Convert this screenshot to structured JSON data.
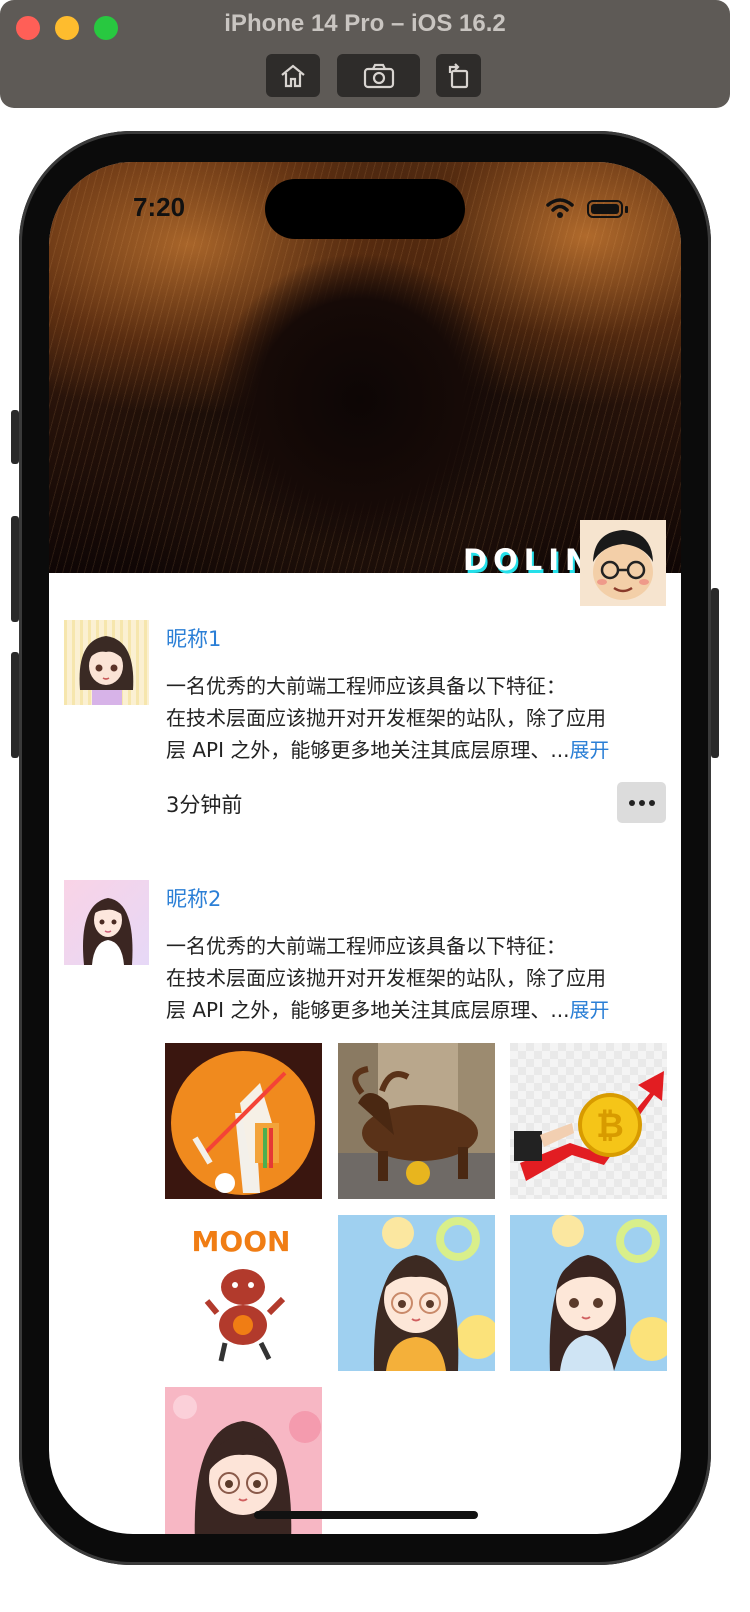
{
  "simulator": {
    "title": "iPhone 14 Pro – iOS 16.2",
    "buttons": [
      "home",
      "screenshot",
      "rotate"
    ]
  },
  "status_bar": {
    "time": "7:20"
  },
  "profile": {
    "brand_text": "DOLIN"
  },
  "posts": [
    {
      "nickname": "昵称1",
      "text_lines": [
        "一名优秀的大前端工程师应该具备以下特征：",
        "在技术层面应该抛开对开发框架的站队，除了应用",
        "层 API 之外，能够更多地关注其底层原理、..."
      ],
      "expand_label": "展开",
      "time": "3分钟前"
    },
    {
      "nickname": "昵称2",
      "text_lines": [
        "一名优秀的大前端工程师应该具备以下特征：",
        "在技术层面应该抛开对开发框架的站队，除了应用",
        "层 API 之外，能够更多地关注其底层原理、..."
      ],
      "expand_label": "展开",
      "images": [
        {
          "name": "bitcoin-cartoon-orange"
        },
        {
          "name": "bull-statue-bitcoin"
        },
        {
          "name": "bitcoin-arrow-up"
        },
        {
          "name": "moon-bull-cartoon",
          "text": "MOON"
        },
        {
          "name": "girl-avatar-glasses"
        },
        {
          "name": "girl-avatar-braids"
        },
        {
          "name": "girl-avatar-pink"
        }
      ]
    }
  ]
}
